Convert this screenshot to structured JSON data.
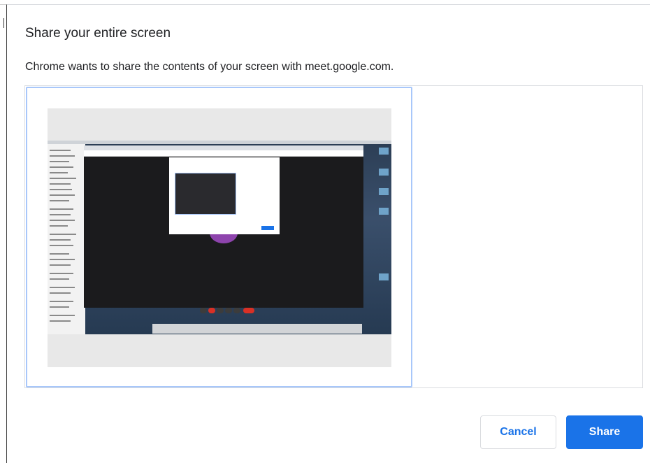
{
  "dialog": {
    "title": "Share your entire screen",
    "description": "Chrome wants to share the contents of your screen with meet.google.com."
  },
  "sources": {
    "items": [
      {
        "type": "entire-screen",
        "selected": true
      }
    ]
  },
  "actions": {
    "cancel_label": "Cancel",
    "share_label": "Share"
  },
  "colors": {
    "accent": "#1a73e8",
    "selection_border": "#a8c7fa",
    "text": "#202124",
    "border": "#dadce0"
  }
}
